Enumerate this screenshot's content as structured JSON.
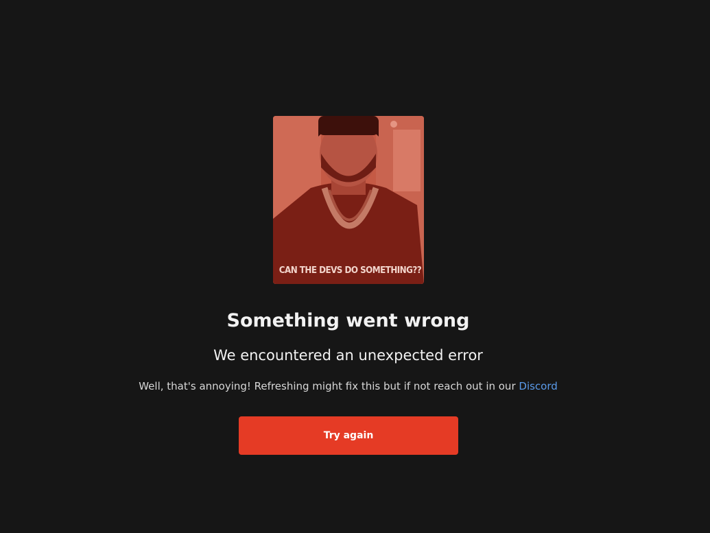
{
  "error": {
    "title": "Something went wrong",
    "subtitle": "We encountered an unexpected error",
    "message_prefix": "Well, that's annoying! Refreshing might fix this but if not reach out in our ",
    "discord_link": "Discord",
    "retry_button": "Try again"
  },
  "meme": {
    "caption": "CAN THE DEVS DO SOMETHING??"
  },
  "colors": {
    "background": "#161616",
    "accent": "#e53b25",
    "link": "#5b9bea",
    "meme_tint": "#b03a2a"
  }
}
